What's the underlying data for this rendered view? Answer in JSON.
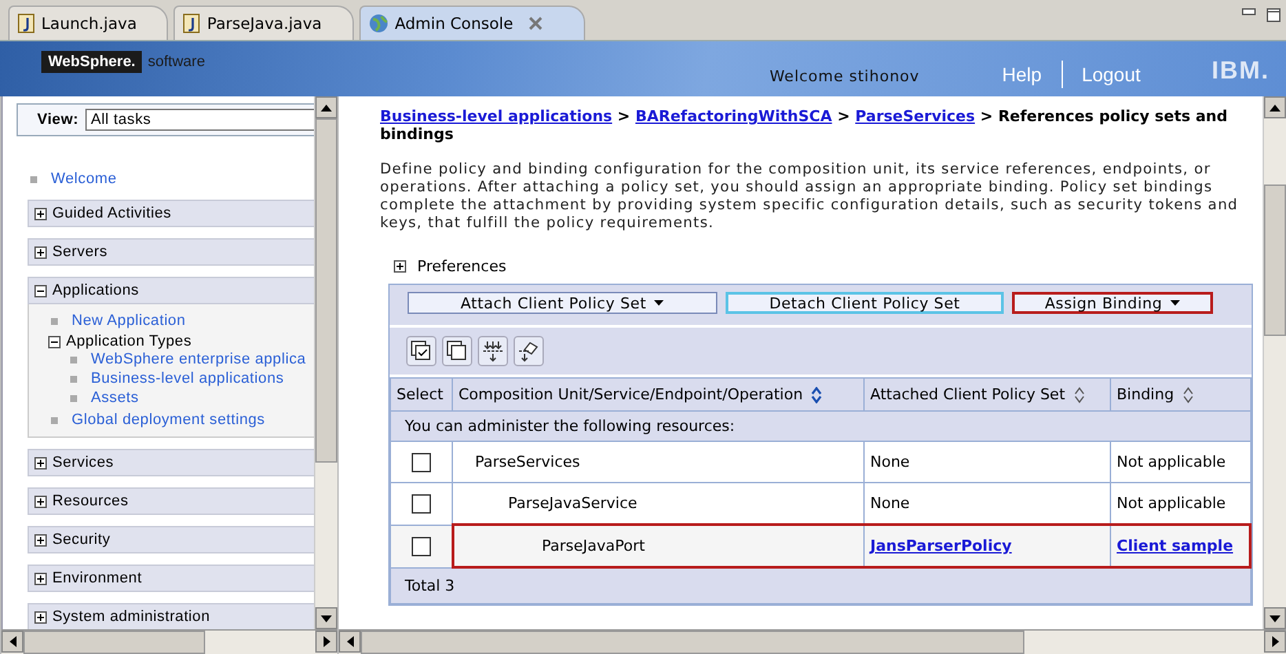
{
  "editor_tabs": [
    {
      "label": "Launch.java",
      "kind": "java",
      "selected": false,
      "closable": false
    },
    {
      "label": "ParseJava.java",
      "kind": "java",
      "selected": false,
      "closable": false
    },
    {
      "label": "Admin Console",
      "kind": "web",
      "selected": true,
      "closable": true
    }
  ],
  "banner": {
    "logo": "WebSphere.",
    "logo_suffix": "software",
    "welcome": "Welcome stihonov",
    "links": [
      "Help",
      "Logout"
    ],
    "brand": "IBM."
  },
  "sidebar": {
    "view_label": "View:",
    "view_value": "All tasks",
    "items": [
      {
        "kind": "link",
        "label": "Welcome"
      },
      {
        "kind": "section",
        "label": "Guided Activities",
        "expanded": false
      },
      {
        "kind": "section",
        "label": "Servers",
        "expanded": false
      },
      {
        "kind": "section",
        "label": "Applications",
        "expanded": true,
        "children": [
          {
            "kind": "link",
            "label": "New Application"
          },
          {
            "kind": "group",
            "label": "Application Types",
            "expanded": true,
            "children": [
              {
                "kind": "link",
                "label": "WebSphere enterprise applica"
              },
              {
                "kind": "link",
                "label": "Business-level applications"
              },
              {
                "kind": "link",
                "label": "Assets"
              }
            ]
          },
          {
            "kind": "link",
            "label": "Global deployment settings"
          }
        ]
      },
      {
        "kind": "section",
        "label": "Services",
        "expanded": false
      },
      {
        "kind": "section",
        "label": "Resources",
        "expanded": false
      },
      {
        "kind": "section",
        "label": "Security",
        "expanded": false
      },
      {
        "kind": "section",
        "label": "Environment",
        "expanded": false
      },
      {
        "kind": "section",
        "label": "System administration",
        "expanded": false
      }
    ]
  },
  "breadcrumb": {
    "separator": ">",
    "items": [
      {
        "label": "Business-level applications",
        "link": true
      },
      {
        "label": "BARefactoringWithSCA",
        "link": true
      },
      {
        "label": "ParseServices",
        "link": true
      },
      {
        "label": "References policy sets and bindings",
        "link": false
      }
    ]
  },
  "description": "Define policy and binding configuration for the composition unit, its service references, endpoints, or operations. After attaching a policy set, you should assign an appropriate binding. Policy set bindings complete the attachment by providing system specific configuration details, such as security tokens and keys, that fulfill the policy requirements.",
  "preferences": {
    "label": "Preferences",
    "expanded": false
  },
  "action_buttons": [
    {
      "label": "Attach Client Policy Set",
      "dropdown": true,
      "focused": false,
      "highlighted": false
    },
    {
      "label": "Detach Client Policy Set",
      "dropdown": false,
      "focused": true,
      "highlighted": false
    },
    {
      "label": "Assign Binding",
      "dropdown": true,
      "focused": false,
      "highlighted": true
    }
  ],
  "table": {
    "columns": [
      {
        "label": "Select",
        "sortable": false
      },
      {
        "label": "Composition Unit/Service/Endpoint/Operation",
        "sortable": true,
        "sorted": true
      },
      {
        "label": "Attached Client Policy Set",
        "sortable": true,
        "sorted": false
      },
      {
        "label": "Binding",
        "sortable": true,
        "sorted": false
      }
    ],
    "group_label": "You can administer the following resources:",
    "rows": [
      {
        "name": "ParseServices",
        "checked": false,
        "policy_set": "None",
        "policy_link": false,
        "binding": "Not applicable",
        "binding_link": false,
        "highlighted": false,
        "children": [
          {
            "name": "ParseJavaService",
            "checked": false,
            "policy_set": "None",
            "policy_link": false,
            "binding": "Not applicable",
            "binding_link": false,
            "highlighted": false,
            "children": [
              {
                "name": "ParseJavaPort",
                "checked": false,
                "policy_set": "JansParserPolicy",
                "policy_link": true,
                "binding": "Client sample",
                "binding_link": true,
                "highlighted": true
              }
            ]
          }
        ]
      }
    ],
    "total": "Total 3"
  }
}
